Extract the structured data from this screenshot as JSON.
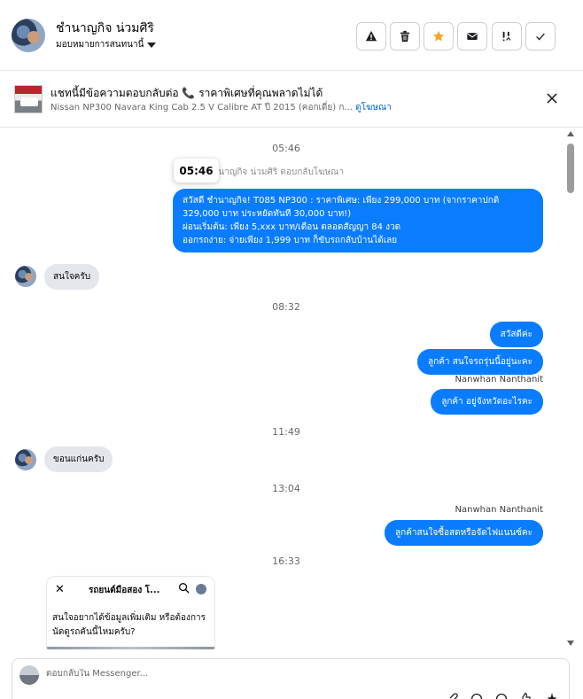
{
  "header": {
    "contact_name": "ชำนาญกิจ น่วมศิริ",
    "assign_label": "มอบหมายการสนทนานี้",
    "actions": [
      {
        "name": "spam-icon"
      },
      {
        "name": "trash-icon"
      },
      {
        "name": "star-icon",
        "color": "#f5a623"
      },
      {
        "name": "envelope-icon"
      },
      {
        "name": "follow-up-icon"
      },
      {
        "name": "checkmark-icon"
      }
    ]
  },
  "ad_banner": {
    "title": "แชทนี้มีข้อความตอบกลับต่อ",
    "phone_glyph": "📞",
    "title_suffix": "ราคาพิเศษที่คุณพลาดไม่ได้",
    "subtitle": "Nissan NP300 Navara King Cab 2.5 V Calibre AT ปี 2015 (คอกเดี่ย) ก...",
    "link": "ดูโฆษณา"
  },
  "conversation": {
    "timestamps": [
      "05:46",
      "08:32",
      "11:49",
      "13:04",
      "16:33"
    ],
    "tooltip": "05:46",
    "replied_note": "ชำนาญกิจ น่วมศิริ ตอบกลับโฆษณา",
    "ad_reply_lines": [
      "สวัสดี ชำนาญกิจ! T085 NP300 : ราคาพิเศษ: เพียง 299,000 บาท (จากราคาปกติ",
      "329,000 บาท ประหยัดทันที 30,000 บาท!)",
      "ผ่อนเริ่มต้น: เพียง 5,xxx บาท/เดือน ตลอดสัญญา 84 งวด",
      "ออกรถง่าย: จ่ายเพียง 1,999 บาท ก็ขับรถกลับบ้านได้เลย"
    ],
    "incoming_1": "สนใจครับ",
    "outgoing_1": "สวัสดีค่ะ",
    "outgoing_2": "ลูกค้า  สนใจรถรุ่นนี้อยู่นะคะ",
    "sender_1": "Nanwhan Nanthanit",
    "outgoing_3": "ลูกค้า อยู่จังหวัดอะไรคะ",
    "incoming_2": "ขอนแก่นครับ",
    "sender_2": "Nanwhan Nanthanit",
    "outgoing_4": "ลูกค้าสนใจซื้อสดหรือจัดไฟแนนซ์คะ",
    "shared_card": {
      "close_glyph": "✕",
      "title": "รถยนต์มือสอง โ...",
      "text": "สนใจอยากได้ข้อมูลเพิ่มเติม หรือต้องการนัดดูรถคันนี้ไหมครับ?"
    }
  },
  "composer": {
    "placeholder": "ตอบกลับใน Messenger..."
  },
  "colors": {
    "outgoing_bubble": "#0a7cff",
    "incoming_bubble": "#e4e6eb",
    "link": "#0064d1"
  }
}
